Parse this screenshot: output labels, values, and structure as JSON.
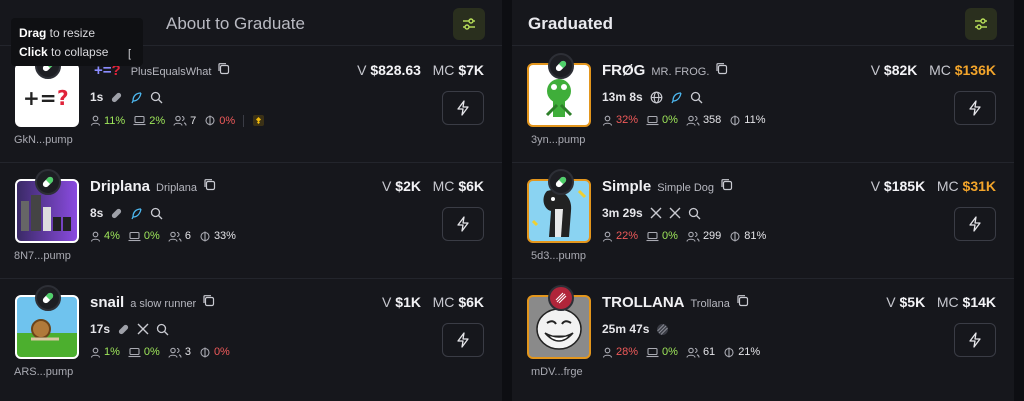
{
  "columns": {
    "left": {
      "title": "About to Graduate"
    },
    "right": {
      "title": "Graduated"
    }
  },
  "tooltip": {
    "drag": "Drag",
    "drag_rest": " to resize",
    "click": "Click",
    "click_rest": " to collapse",
    "key": "["
  },
  "left_cards": [
    {
      "ticker": "+=?",
      "name": "PlusEqualsWhat",
      "age": "1s",
      "address": "GkN...pump",
      "volume": "$828.63",
      "mcap": "$7K",
      "stats": {
        "top10": "11%",
        "dev": "2%",
        "holders": "7",
        "snipers": "0%"
      }
    },
    {
      "ticker": "Driplana",
      "name": "Driplana",
      "age": "8s",
      "address": "8N7...pump",
      "volume": "$2K",
      "mcap": "$6K",
      "stats": {
        "top10": "4%",
        "dev": "0%",
        "holders": "6",
        "snipers": "33%"
      }
    },
    {
      "ticker": "snail",
      "name": "a slow runner",
      "age": "17s",
      "address": "ARS...pump",
      "volume": "$1K",
      "mcap": "$6K",
      "stats": {
        "top10": "1%",
        "dev": "0%",
        "holders": "3",
        "snipers": "0%"
      }
    }
  ],
  "right_cards": [
    {
      "ticker": "FRØG",
      "name": "MR. FROG.",
      "age": "13m 8s",
      "address": "3yn...pump",
      "volume": "$82K",
      "mcap": "$136K",
      "stats": {
        "top10": "32%",
        "dev": "0%",
        "holders": "358",
        "snipers": "11%"
      }
    },
    {
      "ticker": "Simple",
      "name": "Simple Dog",
      "age": "3m 29s",
      "address": "5d3...pump",
      "volume": "$185K",
      "mcap": "$31K",
      "stats": {
        "top10": "22%",
        "dev": "0%",
        "holders": "299",
        "snipers": "81%"
      }
    },
    {
      "ticker": "TROLLANA",
      "name": "Trollana",
      "age": "25m 47s",
      "address": "mDV...frge",
      "volume": "$5K",
      "mcap": "$14K",
      "stats": {
        "top10": "28%",
        "dev": "0%",
        "holders": "61",
        "snipers": "21%"
      }
    }
  ],
  "labels": {
    "v": "V",
    "mc": "MC"
  },
  "colors": {
    "accent_green": "#9ee65a",
    "red": "#ef5a5a",
    "orange": "#f3a52b",
    "bg": "#16171c"
  }
}
